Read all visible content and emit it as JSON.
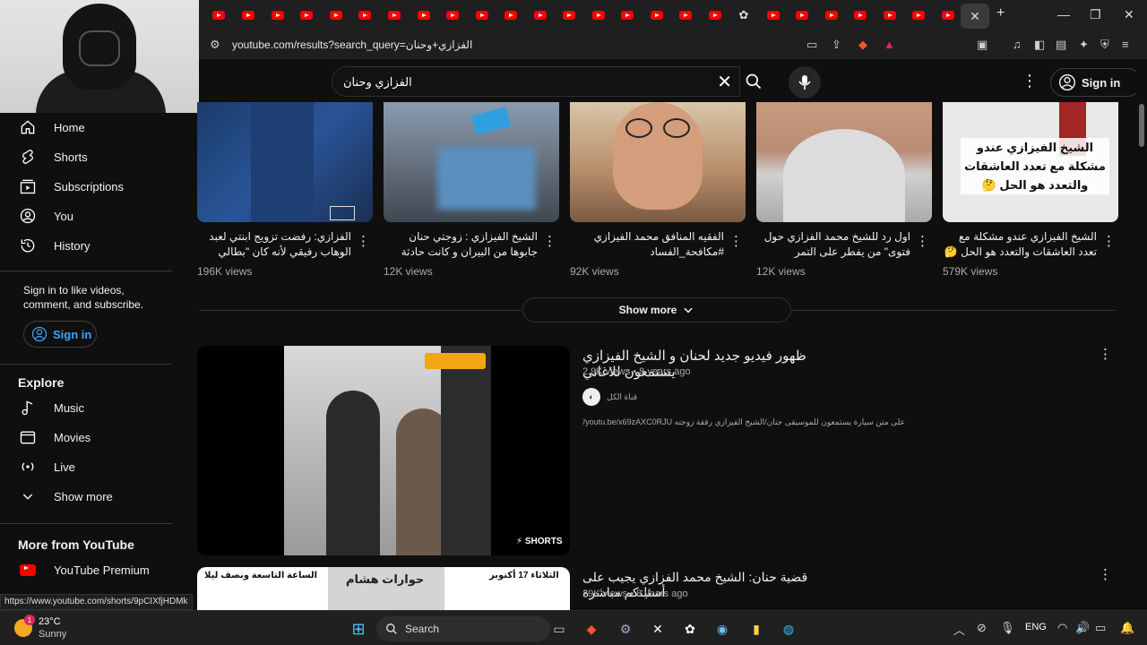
{
  "browser": {
    "url": "youtube.com/results?search_query=الفزازي+وحنان",
    "tab_close": "✕",
    "new_tab": "+"
  },
  "masthead": {
    "search_query": "الفزازي وحنان",
    "sign_in": "Sign in"
  },
  "sidebar": {
    "items": [
      {
        "label": "Home",
        "icon": "home-icon"
      },
      {
        "label": "Shorts",
        "icon": "shorts-icon"
      },
      {
        "label": "Subscriptions",
        "icon": "subscriptions-icon"
      },
      {
        "label": "You",
        "icon": "user-icon"
      },
      {
        "label": "History",
        "icon": "history-icon"
      }
    ],
    "signin_message": "Sign in to like videos, comment, and subscribe.",
    "signin_button": "Sign in",
    "explore_heading": "Explore",
    "explore_items": [
      {
        "label": "Music",
        "icon": "music-icon"
      },
      {
        "label": "Movies",
        "icon": "movies-icon"
      },
      {
        "label": "Live",
        "icon": "live-icon"
      },
      {
        "label": "Show more",
        "icon": "chevron-down-icon"
      }
    ],
    "more_heading": "More from YouTube",
    "more_items": [
      {
        "label": "YouTube Premium",
        "icon": "youtube-premium-icon"
      }
    ]
  },
  "shorts": [
    {
      "title": "الفزازي: رفضت تزويج ابنتي لعبد الوهاب رفيقي لأنه كان \"بطالي وبدور...",
      "views": "196K views"
    },
    {
      "title": "الشيخ الفيزازي : زوجتي حنان جابوها من البيران و كانت حادثة سير، و ...",
      "views": "12K views"
    },
    {
      "title": "الفقيه المنافق محمد الفيزازي #مكافحة_الفساد",
      "views": "92K views"
    },
    {
      "title": "اول رد للشيخ محمد الفزازي حول فتوى\" من يفطر على التمر الجزائري...",
      "views": "12K views"
    },
    {
      "title": "الشيخ الفيزازي عندو مشكلة مع تعدد العاشقات والتعدد هو الحل 🤔 ...",
      "views": "579K views"
    }
  ],
  "short5_overlay": "الشيخ الفيزازي عندو مشكلة مع تعدد العاشقات والتعدد هو الحل 🤔",
  "show_more": "Show more",
  "results": [
    {
      "title": "ظهور فيديو جديد لحنان و الشيخ الفيزازي يستمعون للاغاني",
      "views": "2.9K views",
      "age": "8 years ago",
      "channel": "قناة الكل",
      "description": "على متن سيارة يستمعون للموسيقى حنان/الشيخ الفيزازي رفقة زوجته https://youtu.be/x69zAXC0RJU",
      "badge": "SHORTS"
    },
    {
      "title": "قضية حنان: الشيخ محمد الفزازي يجيب على أسئلتكم مباشرة",
      "views": "29K views",
      "age": "8 years ago",
      "thumb_text_1": "الثلاثاء 17 أكتوبر",
      "thumb_text_2": "حوارات هشام",
      "thumb_text_3": "الساعة التاسعة ونصف ليلا"
    }
  ],
  "status_url": "https://www.youtube.com/shorts/9pCIXfjHDMk",
  "taskbar": {
    "temp": "23°C",
    "condition": "Sunny",
    "weather_badge": "1",
    "search": "Search",
    "lang": "ENG"
  },
  "colors": {
    "background": "#0f0f0f",
    "youtube_red": "#ff0000",
    "link_blue": "#3ea6ff"
  }
}
